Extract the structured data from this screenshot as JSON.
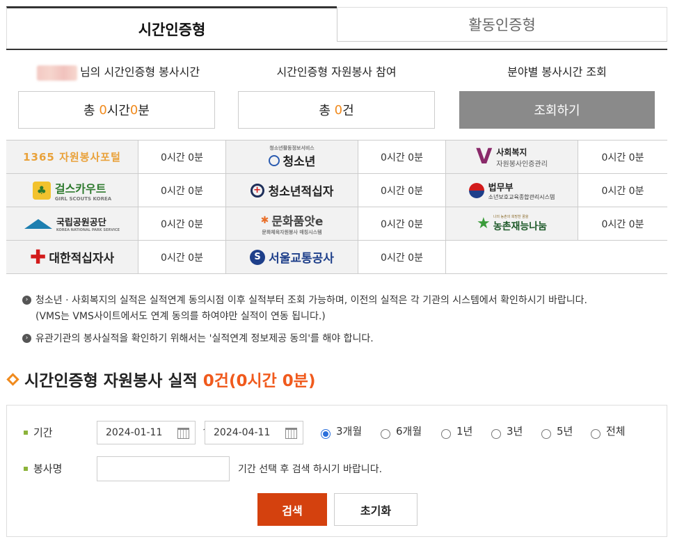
{
  "tabs": {
    "active": "시간인증형",
    "inactive": "활동인증형"
  },
  "summary": {
    "col1_label": "님의 시간인증형 봉사시간",
    "col2_label": "시간인증형 자원봉사 참여",
    "col3_label": "분야별 봉사시간 조회",
    "total_prefix": "총 ",
    "hours": "0",
    "hours_unit": "시간 ",
    "minutes": "0",
    "minutes_unit": "분",
    "count": "0",
    "count_unit": "건",
    "lookup_button": "조회하기"
  },
  "orgs": [
    {
      "logo": "1365 자원봉사포털",
      "value": "0시간 0분",
      "icon": "1365-logo"
    },
    {
      "logo": "청소년",
      "sub": "청소년활동정보서비스",
      "value": "0시간 0분",
      "icon": "youth-logo"
    },
    {
      "logo": "사회복지",
      "sub2": "자원봉사인증관리",
      "value": "0시간 0분",
      "icon": "social-welfare-logo"
    },
    {
      "logo": "걸스카우트",
      "sub": "GIRL SCOUTS KOREA",
      "value": "0시간 0분",
      "icon": "girl-scouts-logo"
    },
    {
      "logo": "청소년적십자",
      "value": "0시간 0분",
      "icon": "youth-red-cross-logo"
    },
    {
      "logo": "법무부",
      "sub": "소년보호교육종합관리시스템",
      "value": "0시간 0분",
      "icon": "ministry-justice-logo"
    },
    {
      "logo": "국립공원공단",
      "sub": "KOREA NATIONAL PARK SERVICE",
      "value": "0시간 0분",
      "icon": "national-park-logo"
    },
    {
      "logo": "문화품앗e",
      "sub": "문화체육자원봉사 매칭시스템",
      "value": "0시간 0분",
      "icon": "culture-logo"
    },
    {
      "logo": "농촌재능나눔",
      "sub": "나의 농촌의 희망찬 꿈을",
      "value": "0시간 0분",
      "icon": "rural-talent-logo"
    },
    {
      "logo": "대한적십자사",
      "value": "0시간 0분",
      "icon": "red-cross-logo"
    },
    {
      "logo": "서울교통공사",
      "value": "0시간 0분",
      "icon": "seoul-metro-logo"
    }
  ],
  "notes": {
    "line1": "청소년 · 사회복지의 실적은 실적연계 동의시점 이후 실적부터 조회 가능하며, 이전의 실적은 각 기관의 시스템에서 확인하시기 바랍니다.",
    "line1b": "(VMS는 VMS사이트에서도 연계 동의를 하여야만 실적이 연동 됩니다.)",
    "line2": "유관기관의 봉사실적을 확인하기 위해서는 '실적연계 정보제공 동의'를 해야 합니다."
  },
  "section": {
    "title": "시간인증형 자원봉사 실적",
    "count": "0건(0시간 0분)"
  },
  "search": {
    "period_label": "기간",
    "start_date": "2024-01-11",
    "tilde": "~",
    "end_date": "2024-04-11",
    "ranges": [
      "3개월",
      "6개월",
      "1년",
      "3년",
      "5년",
      "전체"
    ],
    "selected_range": "3개월",
    "name_label": "봉사명",
    "name_value": "",
    "hint": "기간 선택 후 검색 하시기 바랍니다.",
    "search_button": "검색",
    "reset_button": "초기화"
  },
  "colors": {
    "accent": "#f08a1d",
    "search_button": "#d4410e",
    "lookup_button": "#8a8a8a",
    "label_square": "#8cb33a"
  }
}
